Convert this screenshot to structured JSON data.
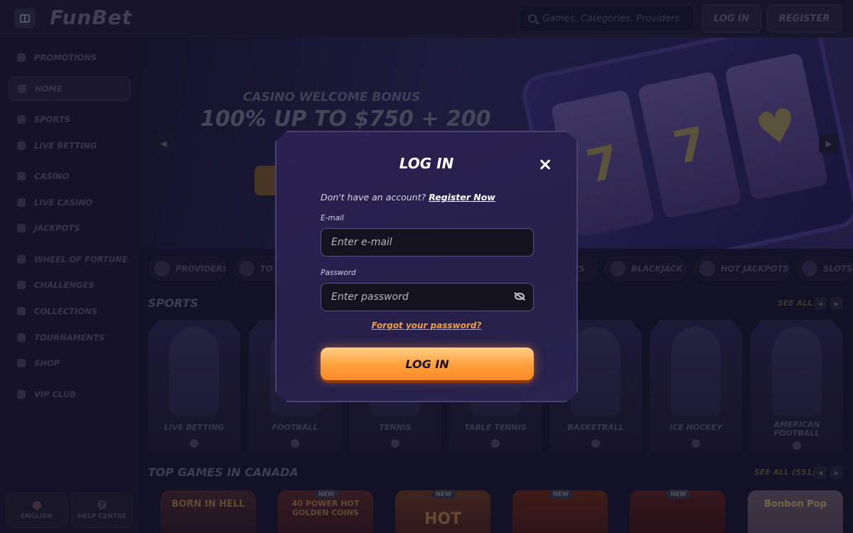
{
  "header": {
    "logo": "FunBet",
    "search_placeholder": "Games, Categories, Providers",
    "login_label": "LOG IN",
    "register_label": "REGISTER"
  },
  "sidebar": {
    "items": [
      {
        "label": "PROMOTIONS",
        "icon": "gift-icon"
      },
      {
        "label": "HOME",
        "icon": "home-icon",
        "active": true
      },
      {
        "label": "SPORTS",
        "icon": "ball-icon"
      },
      {
        "label": "LIVE BETTING",
        "icon": "live-icon"
      },
      {
        "label": "CASINO",
        "icon": "casino-icon"
      },
      {
        "label": "LIVE CASINO",
        "icon": "cards-icon"
      },
      {
        "label": "JACKPOTS",
        "icon": "jackpot-icon"
      },
      {
        "label": "WHEEL OF FORTUNE",
        "icon": "wheel-icon"
      },
      {
        "label": "CHALLENGES",
        "icon": "medal-icon"
      },
      {
        "label": "COLLECTIONS",
        "icon": "collection-icon"
      },
      {
        "label": "TOURNAMENTS",
        "icon": "trophy-icon"
      },
      {
        "label": "SHOP",
        "icon": "shop-icon"
      },
      {
        "label": "VIP CLUB",
        "icon": "crown-icon"
      }
    ],
    "language_label": "ENGLISH",
    "help_label": "HELP CENTRE"
  },
  "banner": {
    "subtitle": "CASINO WELCOME BONUS",
    "title": "100% UP TO $750 + 200"
  },
  "categories": [
    "PROVIDERS",
    "TO",
    "WS",
    "BLACKJACK",
    "HOT JACKPOTS",
    "SLOTS"
  ],
  "sports_section": {
    "title": "SPORTS",
    "see_all": "SEE ALL",
    "cards": [
      "LIVE BETTING",
      "FOOTBALL",
      "TENNIS",
      "TABLE TENNIS",
      "BASKETBALL",
      "ICE HOCKEY",
      "AMERICAN FOOTBALL"
    ]
  },
  "games_section": {
    "title": "TOP GAMES IN CANADA",
    "see_all": "SEE ALL (551)",
    "new_badge": "NEW",
    "tiles": [
      "BORN IN HELL",
      "40 POWER HOT GOLDEN COINS",
      "HOT",
      "",
      "",
      "Bonbon Pop"
    ]
  },
  "modal": {
    "title": "LOG IN",
    "no_account_text": "Don't have an account?",
    "register_link": "Register Now",
    "email_label": "E-mail",
    "email_placeholder": "Enter e-mail",
    "password_label": "Password",
    "password_placeholder": "Enter password",
    "forgot_link": "Forgot your password?",
    "login_button": "LOG IN"
  },
  "colors": {
    "background": "#1b1730",
    "accent_orange": "#ff9f3a",
    "link_orange": "#e8a24a",
    "modal_bg": "#2b2052"
  }
}
